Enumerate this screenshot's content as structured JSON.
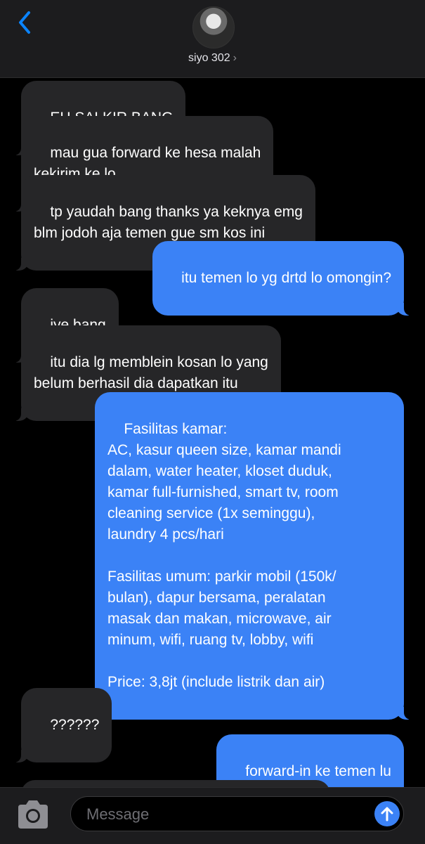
{
  "header": {
    "contact_name": "siyo 302",
    "chevron": "›",
    "back_icon": "chevron-left-icon",
    "accent_color": "#0a84ff"
  },
  "messages": [
    {
      "direction": "in",
      "text": "EH SALKIR BANG"
    },
    {
      "direction": "in",
      "text": "mau gua forward ke hesa malah\nkekirim ke lo"
    },
    {
      "direction": "in",
      "text": "tp yaudah bang thanks ya keknya emg\nblm jodoh aja temen gue sm kos ini"
    },
    {
      "direction": "out",
      "text": "itu temen lo yg drtd lo omongin?"
    },
    {
      "direction": "in",
      "text": "iye bang"
    },
    {
      "direction": "in",
      "text": "itu dia lg memblein kosan lo yang\nbelum berhasil dia dapatkan itu"
    },
    {
      "direction": "out",
      "text": "Fasilitas kamar:\nAC, kasur queen size, kamar mandi\ndalam, water heater, kloset duduk,\nkamar full-furnished, smart tv, room\ncleaning service (1x seminggu),\nlaundry 4 pcs/hari\n\nFasilitas umum: parkir mobil (150k/\nbulan), dapur bersama, peralatan\nmasak dan makan, microwave, air\nminum, wifi, ruang tv, lobby, wifi\n\nPrice: 3,8jt (include listrik dan air)"
    },
    {
      "direction": "in",
      "text": "??????"
    },
    {
      "direction": "out",
      "text": "forward-in ke temen lu"
    },
    {
      "direction": "in",
      "text": ""
    }
  ],
  "composer": {
    "placeholder": "Message",
    "camera_icon": "camera-icon",
    "send_icon": "arrow-up-icon"
  },
  "colors": {
    "incoming_bubble": "#262628",
    "outgoing_bubble": "#3b82f6",
    "background": "#000000"
  }
}
